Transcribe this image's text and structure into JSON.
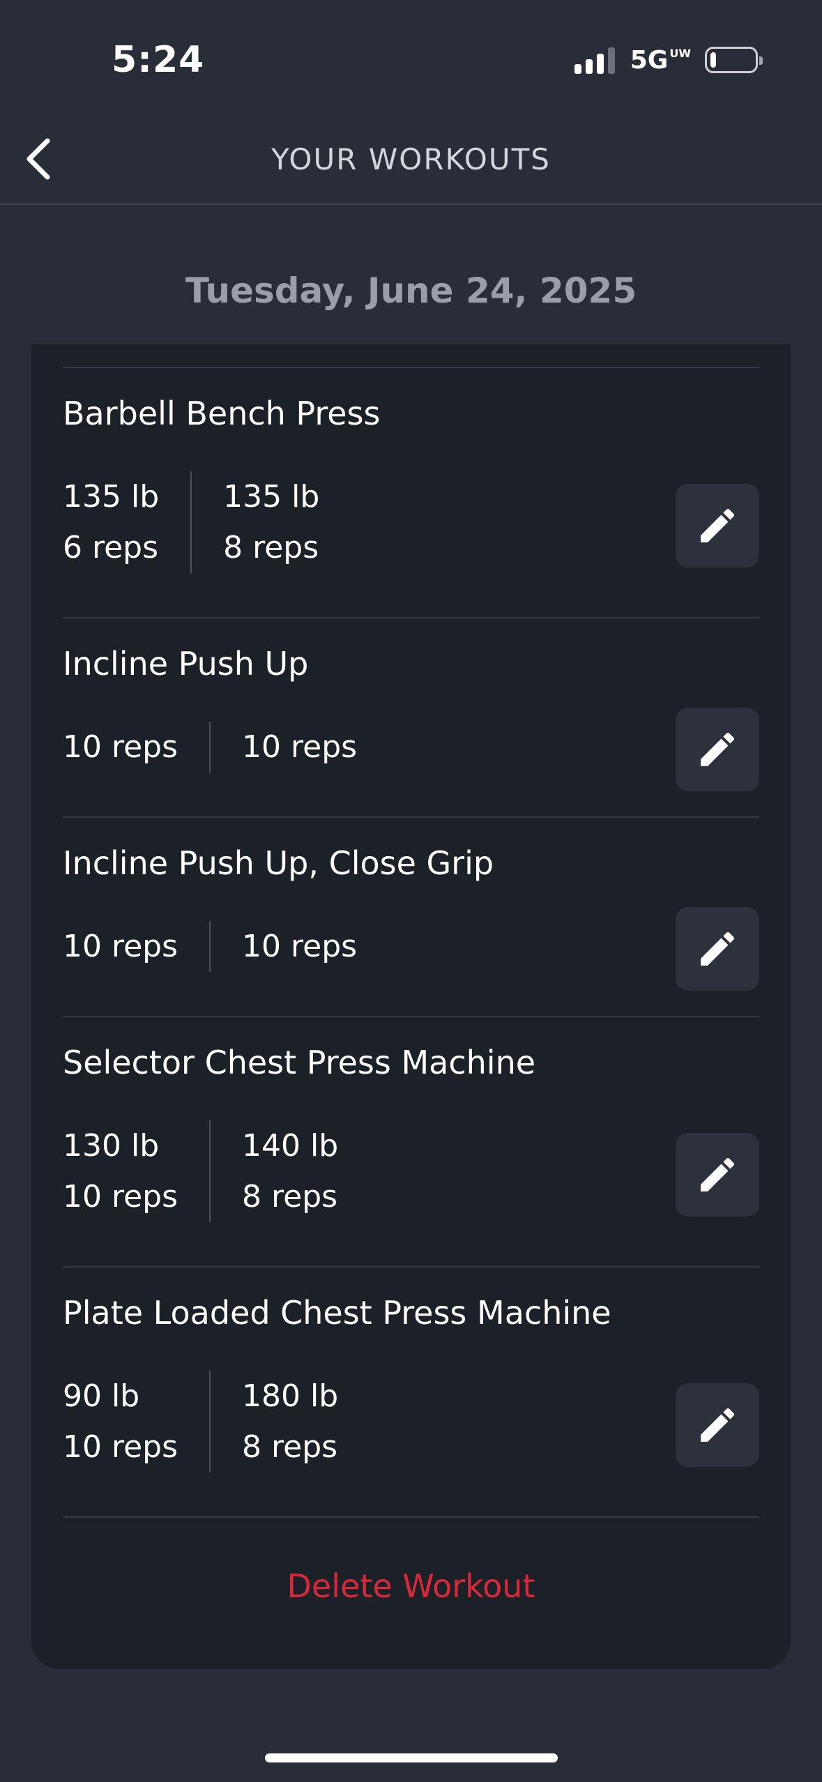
{
  "status_bar": {
    "time": "5:24",
    "network": "5G",
    "network_suffix": "UW",
    "battery_level": 0.12
  },
  "header": {
    "title": "YOUR WORKOUTS"
  },
  "date": "Tuesday, June 24, 2025",
  "exercises": [
    {
      "name": "Barbell Bench Press",
      "sets": [
        {
          "weight": "135 lb",
          "reps": "6 reps"
        },
        {
          "weight": "135 lb",
          "reps": "8 reps"
        }
      ]
    },
    {
      "name": "Incline Push Up",
      "sets": [
        {
          "reps": "10 reps"
        },
        {
          "reps": "10 reps"
        }
      ]
    },
    {
      "name": "Incline Push Up, Close Grip",
      "sets": [
        {
          "reps": "10 reps"
        },
        {
          "reps": "10 reps"
        }
      ]
    },
    {
      "name": "Selector Chest Press Machine",
      "sets": [
        {
          "weight": "130 lb",
          "reps": "10 reps"
        },
        {
          "weight": "140 lb",
          "reps": "8 reps"
        }
      ]
    },
    {
      "name": "Plate Loaded Chest Press Machine",
      "sets": [
        {
          "weight": "90 lb",
          "reps": "10 reps"
        },
        {
          "weight": "180 lb",
          "reps": "8 reps"
        }
      ]
    }
  ],
  "delete_label": "Delete Workout",
  "colors": {
    "background": "#282d38",
    "card": "#1c2027",
    "edit_button": "#2c313c",
    "danger": "#d7283c"
  },
  "icons": {
    "back": "chevron-left-icon",
    "edit": "pencil-icon"
  }
}
